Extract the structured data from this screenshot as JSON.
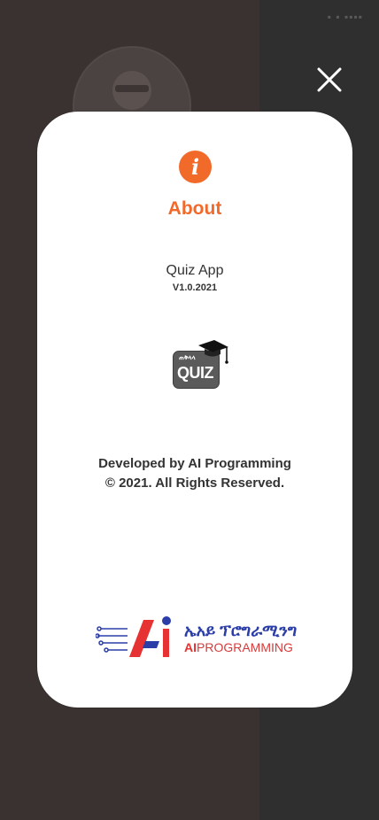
{
  "status_bar": {
    "text": "▪ ▪ ▪▪▪▪"
  },
  "close_icon": "close-icon",
  "about": {
    "icon": "info-icon",
    "icon_glyph": "i",
    "title": "About",
    "app_name": "Quiz App",
    "version": "V1.0.2021",
    "developed_by": "Developed by AI Programming",
    "copyright": "© 2021. All Rights Reserved."
  },
  "quiz_logo": {
    "small_text": "ጠቅላላ",
    "big_text": "QUIZ"
  },
  "brand": {
    "amharic": "ኤአይ ፕሮግራሚንግ",
    "ai": "AI",
    "programming": "PROGRAMMING"
  },
  "colors": {
    "accent": "#f26a2a",
    "overlay_left": "#3a3230",
    "overlay_right": "#2f2f2f",
    "brand_blue": "#2b3ea8",
    "brand_red": "#e63232"
  }
}
